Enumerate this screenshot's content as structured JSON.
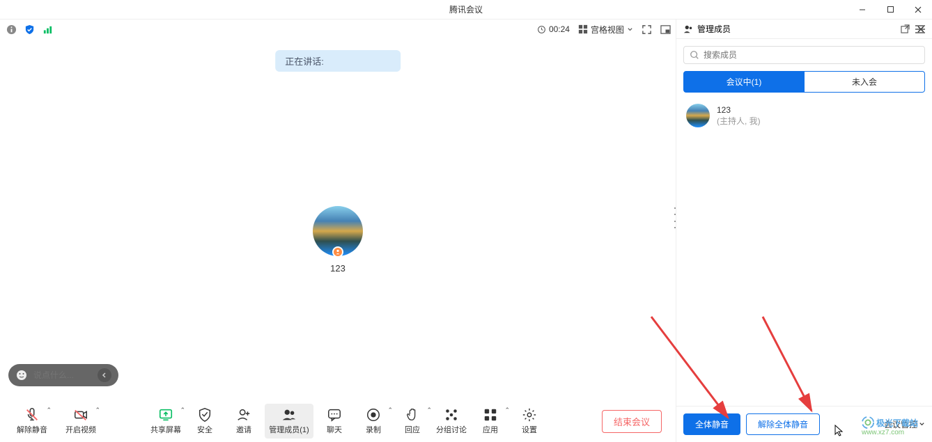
{
  "window": {
    "title": "腾讯会议"
  },
  "toolbar": {
    "timer": "00:24",
    "view_mode": "宫格视图"
  },
  "main": {
    "speaking_label": "正在讲话:",
    "participant_name": "123",
    "chat_placeholder": "说点什么..."
  },
  "bottom": {
    "unmute": "解除静音",
    "video": "开启视频",
    "share": "共享屏幕",
    "security": "安全",
    "invite": "邀请",
    "members": "管理成员(1)",
    "chat": "聊天",
    "record": "录制",
    "reaction": "回应",
    "breakout": "分组讨论",
    "apps": "应用",
    "settings": "设置",
    "end": "结束会议"
  },
  "panel": {
    "title": "管理成员",
    "search_placeholder": "搜索成员",
    "tab_in": "会议中(1)",
    "tab_out": "未入会",
    "member": {
      "name": "123",
      "role": "(主持人, 我)"
    },
    "mute_all": "全体静音",
    "unmute_all": "解除全体静音",
    "meeting_control": "会议管控"
  },
  "watermark": {
    "line1": "极光下载站",
    "line2": "www.xz7.com"
  }
}
